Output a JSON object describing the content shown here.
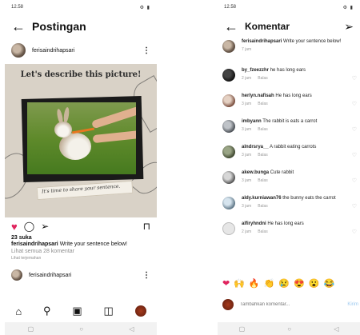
{
  "left": {
    "status_time": "12.58",
    "status_right": "⚙ ▮",
    "title": "Postingan",
    "username": "ferisaindrihapsari",
    "image_title": "Let's describe this picture!",
    "image_caption": "It's time to share your sentence.",
    "likes": "23 suka",
    "caption_user": "ferisaindrihapsari",
    "caption_text": "Write your sentence below!",
    "view_comments": "Lihat semua 28 komentar",
    "disliked_by": "Lihat terjemahan",
    "bottom_user": "ferisaindrihapsari"
  },
  "right": {
    "status_time": "12.58",
    "status_right": "⚙ ▮",
    "title": "Komentar",
    "owner": {
      "user": "ferisaindrihapsari",
      "text": "Write your sentence below!",
      "time": "7 jam"
    },
    "comments": [
      {
        "user": "by_fzeezzhr",
        "text": "he has long ears",
        "time": "2 jam",
        "reply": "Balas"
      },
      {
        "user": "herlyn.nafisah",
        "text": "He has long ears",
        "time": "3 jam",
        "reply": "Balas"
      },
      {
        "user": "imbyann",
        "text": "The rabbit is eats a carrot",
        "time": "3 jam",
        "reply": "Balas"
      },
      {
        "user": "alndrsrya__",
        "text": "A rabbit eating carrots",
        "time": "3 jam",
        "reply": "Balas"
      },
      {
        "user": "akew.bunga",
        "text": "Cute rabbit",
        "time": "3 jam",
        "reply": "Balas"
      },
      {
        "user": "aldy.kurniawan76",
        "text": "the bunny eats the carrot",
        "time": "3 jam",
        "reply": "Balas"
      },
      {
        "user": "alfiryhndni",
        "text": "He has long ears",
        "time": "2 jam",
        "reply": "Balas"
      }
    ],
    "emojis": [
      "❤",
      "🙌",
      "🔥",
      "👏",
      "😢",
      "😍",
      "😮",
      "😂"
    ],
    "add_placeholder": "Tambahkan komentar...",
    "post_label": "Kirim"
  }
}
